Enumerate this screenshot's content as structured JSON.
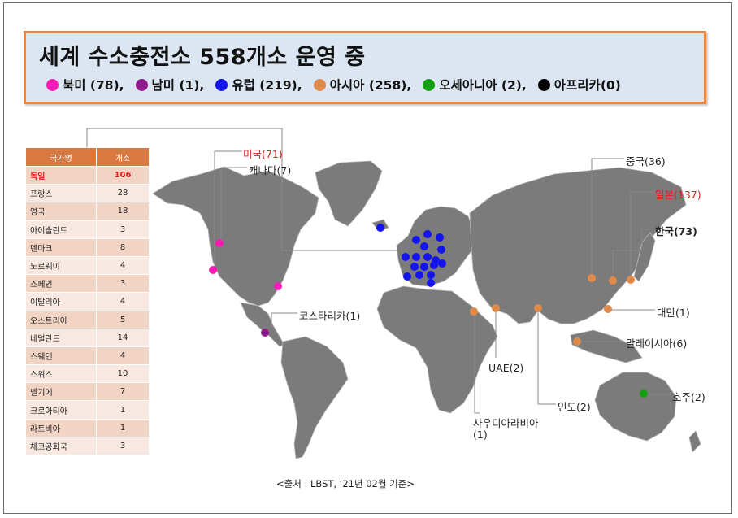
{
  "banner": {
    "title": "세계 수소충전소 558개소 운영 중",
    "legend": [
      {
        "label": "북미 (78),",
        "color": "#ff1ab8",
        "icon": "magenta-dot"
      },
      {
        "label": "남미 (1),",
        "color": "#8e1a8e",
        "icon": "purple-dot"
      },
      {
        "label": "유럽 (219),",
        "color": "#1414ee",
        "icon": "blue-dot"
      },
      {
        "label": "아시아 (258),",
        "color": "#e08a4a",
        "icon": "orange-dot"
      },
      {
        "label": "오세아니아 (2),",
        "color": "#12a012",
        "icon": "green-dot"
      },
      {
        "label": "아프리카(0)",
        "color": "#000000",
        "icon": "black-dot"
      }
    ]
  },
  "table": {
    "headers": [
      "국가명",
      "개소"
    ],
    "rows": [
      {
        "country": "독일",
        "count": "106",
        "highlight": true
      },
      {
        "country": "프랑스",
        "count": "28"
      },
      {
        "country": "영국",
        "count": "18"
      },
      {
        "country": "아이슬란드",
        "count": "3"
      },
      {
        "country": "덴마크",
        "count": "8"
      },
      {
        "country": "노르웨이",
        "count": "4"
      },
      {
        "country": "스페인",
        "count": "3"
      },
      {
        "country": "이탈리아",
        "count": "4"
      },
      {
        "country": "오스트리아",
        "count": "5"
      },
      {
        "country": "네덜란드",
        "count": "14"
      },
      {
        "country": "스웨덴",
        "count": "4"
      },
      {
        "country": "스위스",
        "count": "10"
      },
      {
        "country": "벨기에",
        "count": "7"
      },
      {
        "country": "크로아티아",
        "count": "1"
      },
      {
        "country": "라트비아",
        "count": "1"
      },
      {
        "country": "체코공화국",
        "count": "3"
      }
    ]
  },
  "map_labels": {
    "usa": "미국(71)",
    "canada": "캐나다(7)",
    "costa_rica": "코스타리카(1)",
    "china": "중국(36)",
    "japan": "일본(137)",
    "korea": "한국(73)",
    "taiwan": "대만(1)",
    "malaysia": "말레이시아(6)",
    "australia": "호주(2)",
    "india": "인도(2)",
    "uae": "UAE(2)",
    "saudi_line1": "사우디아라비아",
    "saudi_line2": "(1)"
  },
  "source": "<출처 :  LBST, ‘21년 02월 기준>"
}
